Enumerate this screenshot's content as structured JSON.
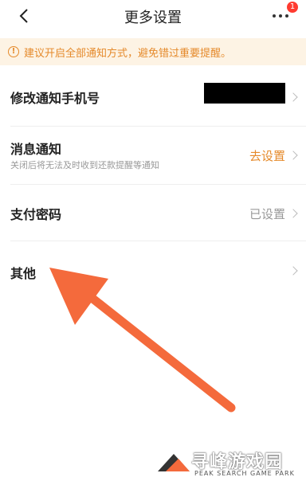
{
  "header": {
    "title": "更多设置",
    "badge_count": "1"
  },
  "notice": {
    "icon": "exclamation-circle-icon",
    "text": "建议开启全部通知方式，避免错过重要提醒。"
  },
  "settings": {
    "phone": {
      "label": "修改通知手机号"
    },
    "message": {
      "label": "消息通知",
      "sub": "关闭后将无法及时收到还款提醒等通知",
      "value": "去设置"
    },
    "payment": {
      "label": "支付密码",
      "value": "已设置"
    },
    "other": {
      "label": "其他"
    }
  },
  "watermark": {
    "text": "寻峰游戏园",
    "sub": "PEAK SEARCH GAME PARK"
  },
  "colors": {
    "accent": "#e58a2b",
    "notice_bg": "#fdf3e4",
    "arrow": "#f46a3c",
    "badge": "#ff3b30"
  }
}
